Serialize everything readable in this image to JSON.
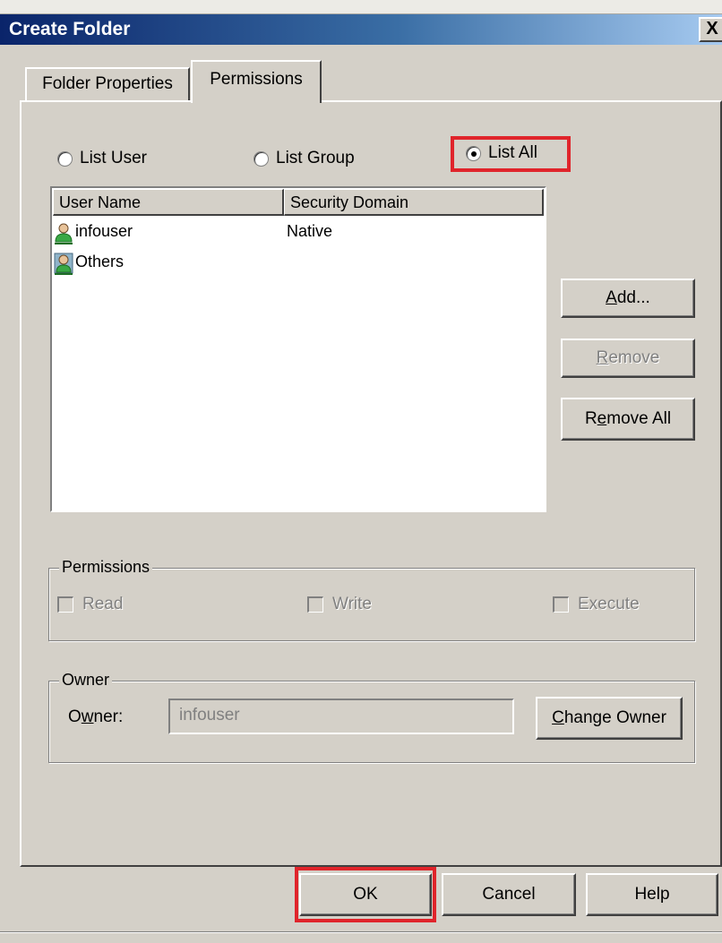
{
  "window": {
    "title": "Create Folder",
    "close_glyph": "X"
  },
  "tabs": [
    {
      "label": "Folder Properties",
      "selected": false
    },
    {
      "label": "Permissions",
      "selected": true
    }
  ],
  "filter": {
    "options": [
      {
        "label": "List User",
        "checked": false
      },
      {
        "label": "List Group",
        "checked": false
      },
      {
        "label": "List All",
        "checked": true
      }
    ]
  },
  "list": {
    "columns": [
      "User Name",
      "Security Domain"
    ],
    "rows": [
      {
        "user": "infouser",
        "domain": "Native",
        "icon": "user-icon"
      },
      {
        "user": "Others",
        "domain": "",
        "icon": "group-icon"
      }
    ]
  },
  "list_buttons": {
    "add": {
      "label": "Add...",
      "mnemonic": "A"
    },
    "remove": {
      "label": "Remove",
      "mnemonic": "R",
      "enabled": false
    },
    "remove_all": {
      "label": "Remove All",
      "mnemonic": "e"
    }
  },
  "permissions": {
    "legend": "Permissions",
    "read": {
      "label": "Read",
      "enabled": false
    },
    "write": {
      "label": "Write",
      "enabled": false
    },
    "execute": {
      "label": "Execute",
      "enabled": false
    }
  },
  "owner": {
    "legend": "Owner",
    "label": "Owner:",
    "value": "infouser",
    "change_button": "Change Owner"
  },
  "footer": {
    "ok": "OK",
    "cancel": "Cancel",
    "help": "Help"
  },
  "colors": {
    "highlight": "#e0242b",
    "titlebar_start": "#0a246a",
    "titlebar_end": "#a6caf0",
    "face": "#d4d0c8"
  }
}
